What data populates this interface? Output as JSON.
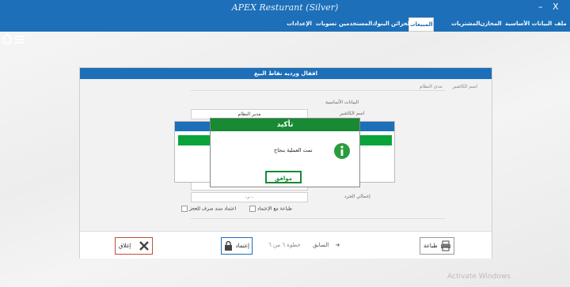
{
  "titlebar": {
    "app_title": "APEX Resturant (Silver)",
    "close": "X",
    "minimize": "–"
  },
  "menu": [
    {
      "label": "ملف"
    },
    {
      "label": "البيانات الأساسية"
    },
    {
      "label": "المخازن"
    },
    {
      "label": "المشتريات"
    },
    {
      "label": "المبيعات",
      "active": true
    },
    {
      "label": "الخزائن"
    },
    {
      "label": "البنوك"
    },
    {
      "label": "المستخدمين"
    },
    {
      "label": "تسويات"
    },
    {
      "label": "الإعدادات"
    }
  ],
  "dialog": {
    "title": "اقفال ورديه نقاط البيع",
    "tabs": [
      "اسم الكاشير",
      "مدى النظام"
    ],
    "section_basic": "البيانات الأساسية",
    "cashier_label": "اسم الكاشير",
    "cashier_value": "مدير النظام",
    "field2_label": "م",
    "field3_label": "إجمالي الجرد",
    "field3_value": "٠٫٠٠",
    "checkbox_print": "طباعة مع الإعتماد",
    "checkbox_approve_receipt": "اعتماد سند صرف للعجز"
  },
  "footer": {
    "print_label": "طباعة",
    "prev_label": "السابق",
    "step_text": "خطوة ٦ من ٦",
    "approve_label": "إعتماد",
    "close_label": "إغلاق"
  },
  "confirm": {
    "title": "تأكيد",
    "message": "تمت العملية بنجاح",
    "ok_label": "موافق"
  },
  "colors": {
    "accent": "#1c6fb8",
    "success": "#178a33",
    "danger": "#c0503a"
  },
  "icons": [
    "home-icon",
    "hamburger-icon",
    "info-icon",
    "printer-icon",
    "lock-icon",
    "close-x-icon",
    "arrow-right-icon"
  ],
  "watermark": "Activate Windows"
}
